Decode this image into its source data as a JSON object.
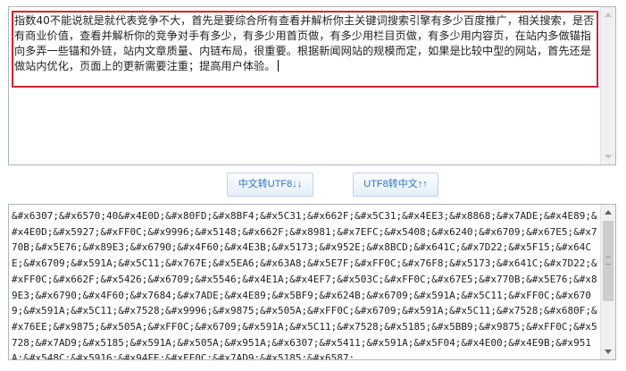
{
  "input_text": "指数40不能说就是就代表竞争不大，首先是要综合所有查看并解析你主关键词搜索引擎有多少百度推广，相关搜索，是否有商业价值，查看并解析你的竞争对手有多少，有多少用首页做，有多少用栏目页做，有多少用内容页，在站内多做锚指向多弄一些锚和外链，站内文章质量、内链布局，很重要。根据新闻网站的规模而定，如果是比较中型的网站，首先还是做站内优化，页面上的更新需要注重；提高用户体验。",
  "buttons": {
    "cn_to_utf8": "中文转UTF8↓↓",
    "utf8_to_cn": "UTF8转中文↑↑"
  },
  "output_text": "&#x6307;&#x6570;40&#x4E0D;&#x80FD;&#x8BF4;&#x5C31;&#x662F;&#x5C31;&#x4EE3;&#x8868;&#x7ADE;&#x4E89;&#x4E0D;&#x5927;&#xFF0C;&#x9996;&#x5148;&#x662F;&#x8981;&#x7EFC;&#x5408;&#x6240;&#x6709;&#x67E5;&#x770B;&#x5E76;&#x89E3;&#x6790;&#x4F60;&#x4E3B;&#x5173;&#x952E;&#x8BCD;&#x641C;&#x7D22;&#x5F15;&#x64CE;&#x6709;&#x591A;&#x5C11;&#x767E;&#x5EA6;&#x63A8;&#x5E7F;&#xFF0C;&#x76F8;&#x5173;&#x641C;&#x7D22;&#xFF0C;&#x662F;&#x5426;&#x6709;&#x5546;&#x4E1A;&#x4EF7;&#x503C;&#xFF0C;&#x67E5;&#x770B;&#x5E76;&#x89E3;&#x6790;&#x4F60;&#x7684;&#x7ADE;&#x4E89;&#x5BF9;&#x624B;&#x6709;&#x591A;&#x5C11;&#xFF0C;&#x6709;&#x591A;&#x5C11;&#x7528;&#x9996;&#x9875;&#x505A;&#xFF0C;&#x6709;&#x591A;&#x5C11;&#x7528;&#x680F;&#x76EE;&#x9875;&#x505A;&#xFF0C;&#x6709;&#x591A;&#x5C11;&#x7528;&#x5185;&#x5BB9;&#x9875;&#xFF0C;&#x5728;&#x7AD9;&#x5185;&#x591A;&#x505A;&#x951A;&#x6307;&#x5411;&#x591A;&#x5F04;&#x4E00;&#x4E9B;&#x951A;&#x548C;&#x5916;&#x94FE;&#xFF0C;&#x7AD9;&#x5185;&#x6587;"
}
